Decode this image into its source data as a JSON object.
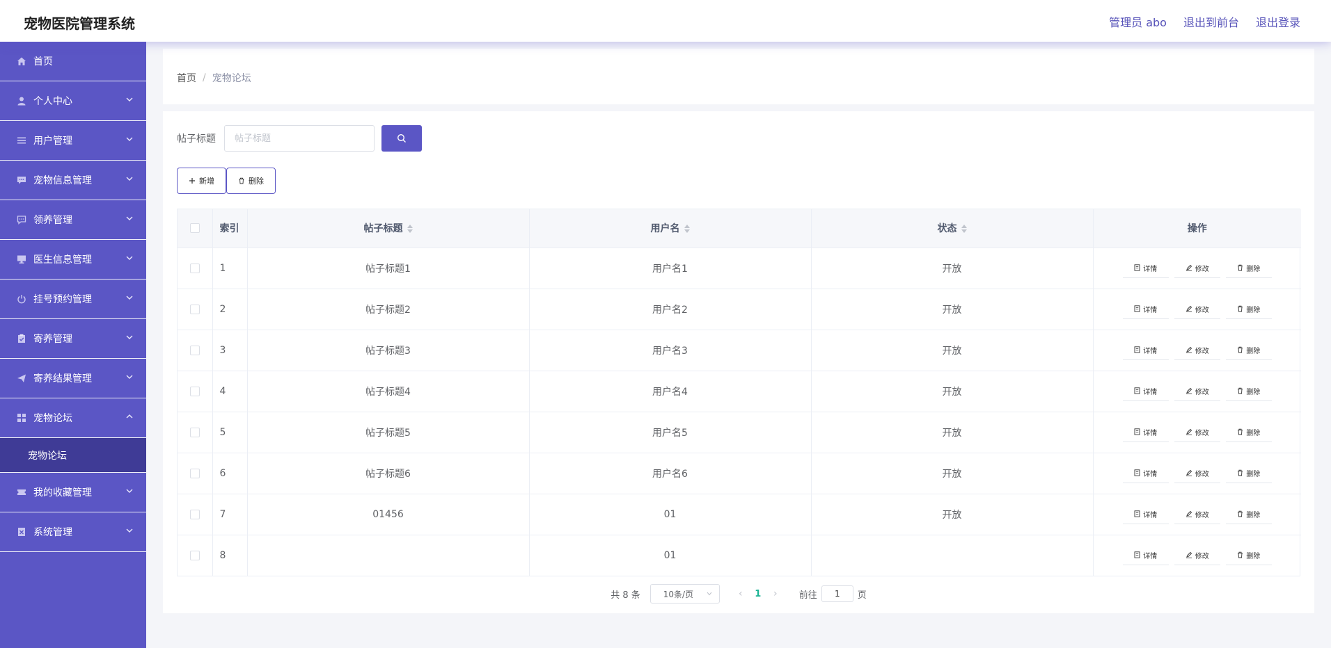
{
  "header": {
    "title": "宠物医院管理系统",
    "links": [
      "管理员 abo",
      "退出到前台",
      "退出登录"
    ]
  },
  "sidebar": {
    "items": [
      {
        "label": "首页",
        "icon": "home-icon",
        "expandable": false
      },
      {
        "label": "个人中心",
        "icon": "user-icon",
        "expandable": true
      },
      {
        "label": "用户管理",
        "icon": "list-icon",
        "expandable": true
      },
      {
        "label": "宠物信息管理",
        "icon": "chat-icon",
        "expandable": true
      },
      {
        "label": "领养管理",
        "icon": "message-icon",
        "expandable": true
      },
      {
        "label": "医生信息管理",
        "icon": "monitor-icon",
        "expandable": true
      },
      {
        "label": "挂号预约管理",
        "icon": "power-icon",
        "expandable": true
      },
      {
        "label": "寄养管理",
        "icon": "clipboard-icon",
        "expandable": true
      },
      {
        "label": "寄养结果管理",
        "icon": "send-icon",
        "expandable": true
      },
      {
        "label": "宠物论坛",
        "icon": "grid-icon",
        "expandable": true,
        "open": true,
        "sub": [
          "宠物论坛"
        ]
      },
      {
        "label": "我的收藏管理",
        "icon": "ticket-icon",
        "expandable": true
      },
      {
        "label": "系统管理",
        "icon": "document-icon",
        "expandable": true
      }
    ]
  },
  "breadcrumb": {
    "home": "首页",
    "separator": "/",
    "current": "宠物论坛"
  },
  "search": {
    "label": "帖子标题",
    "placeholder": "帖子标题",
    "value": ""
  },
  "actions": {
    "add": "新增",
    "delete": "删除"
  },
  "table": {
    "headers": {
      "index": "索引",
      "title": "帖子标题",
      "username": "用户名",
      "status": "状态",
      "ops": "操作"
    },
    "op_labels": {
      "detail": "详情",
      "edit": "修改",
      "delete": "删除"
    },
    "rows": [
      {
        "index": "1",
        "title": "帖子标题1",
        "username": "用户名1",
        "status": "开放"
      },
      {
        "index": "2",
        "title": "帖子标题2",
        "username": "用户名2",
        "status": "开放"
      },
      {
        "index": "3",
        "title": "帖子标题3",
        "username": "用户名3",
        "status": "开放"
      },
      {
        "index": "4",
        "title": "帖子标题4",
        "username": "用户名4",
        "status": "开放"
      },
      {
        "index": "5",
        "title": "帖子标题5",
        "username": "用户名5",
        "status": "开放"
      },
      {
        "index": "6",
        "title": "帖子标题6",
        "username": "用户名6",
        "status": "开放"
      },
      {
        "index": "7",
        "title": "01456",
        "username": "01",
        "status": "开放"
      },
      {
        "index": "8",
        "title": "",
        "username": "01",
        "status": ""
      }
    ]
  },
  "pagination": {
    "total": "共 8 条",
    "page_size": "10条/页",
    "current": "1",
    "goto_prefix": "前往",
    "goto_value": "1",
    "goto_suffix": "页"
  },
  "colors": {
    "accent": "#5b56c5",
    "active_sub": "#3f3b96",
    "page_active": "#19b393"
  }
}
